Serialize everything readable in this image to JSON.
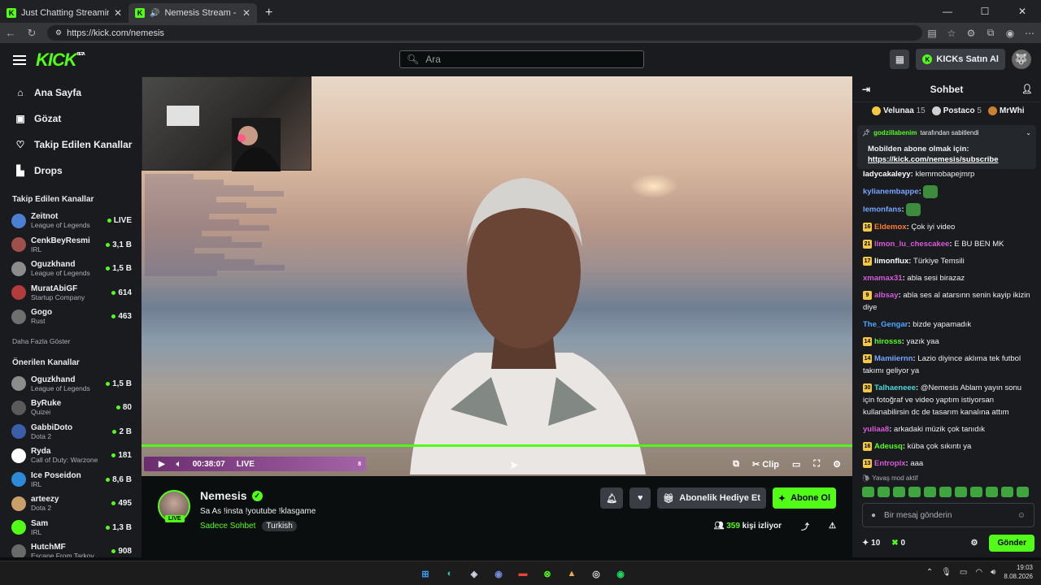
{
  "browser": {
    "tabs": [
      {
        "title": "Just Chatting Streaming - Live Stre",
        "active": false
      },
      {
        "title": "Nemesis Stream - Watch Live",
        "active": true
      }
    ],
    "url": "https://kick.com/nemesis",
    "window_controls": [
      "—",
      "☐",
      "✕"
    ]
  },
  "topnav": {
    "logo": "KICK",
    "logo_beta": "BETA",
    "search_placeholder": "Ara",
    "kicks_button": "KICKs Satın Al"
  },
  "sidebar": {
    "nav": [
      {
        "label": "Ana Sayfa",
        "icon": "home-icon"
      },
      {
        "label": "Gözat",
        "icon": "browse-icon"
      },
      {
        "label": "Takip Edilen Kanallar",
        "icon": "heart-icon"
      },
      {
        "label": "Drops",
        "icon": "drops-icon"
      }
    ],
    "followed_heading": "Takip Edilen Kanallar",
    "followed": [
      {
        "name": "Zeitnot",
        "category": "League of Legends",
        "viewers": "LIVE",
        "color": "#4a7fd4"
      },
      {
        "name": "CenkBeyResmi",
        "category": "IRL",
        "viewers": "3,1 B",
        "color": "#a0504a"
      },
      {
        "name": "Oguzkhand",
        "category": "League of Legends",
        "viewers": "1,5 B",
        "color": "#8c8c8c"
      },
      {
        "name": "MuratAbiGF",
        "category": "Startup Company",
        "viewers": "614",
        "color": "#b23b3b"
      },
      {
        "name": "Gogo",
        "category": "Rust",
        "viewers": "463",
        "color": "#6f6f6f"
      }
    ],
    "show_more": "Daha Fazla Göster",
    "recommended_heading": "Önerilen Kanallar",
    "recommended": [
      {
        "name": "Oguzkhand",
        "category": "League of Legends",
        "viewers": "1,5 B",
        "color": "#8c8c8c"
      },
      {
        "name": "ByRuke",
        "category": "Quizei",
        "viewers": "80",
        "color": "#5a5a5a"
      },
      {
        "name": "GabbiDoto",
        "category": "Dota 2",
        "viewers": "2 B",
        "color": "#3a5fa8"
      },
      {
        "name": "Ryda",
        "category": "Call of Duty: Warzone",
        "viewers": "181",
        "color": "#ffffff"
      },
      {
        "name": "Ice Poseidon",
        "category": "IRL",
        "viewers": "8,6 B",
        "color": "#2d8ad8"
      },
      {
        "name": "arteezy",
        "category": "Dota 2",
        "viewers": "495",
        "color": "#c9a06a"
      },
      {
        "name": "Sam",
        "category": "IRL",
        "viewers": "1,3 B",
        "color": "#53fc18"
      },
      {
        "name": "HutchMF",
        "category": "Escape From Tarkov",
        "viewers": "908",
        "color": "#6a6a6a"
      }
    ]
  },
  "player": {
    "time": "00:38:07",
    "live_label": "LIVE",
    "clip_label": "Clip",
    "volume_level": "8"
  },
  "stream": {
    "name": "Nemesis",
    "live_badge": "LIVE",
    "title": "Sa As  !insta !youtube !klasgame",
    "category": "Sadece Sohbet",
    "tag": "Turkish",
    "gift_button": "Abonelik Hediye Et",
    "subscribe_button": "Abone Ol",
    "viewers": "359",
    "viewers_label": "kişi izliyor"
  },
  "chat": {
    "heading": "Sohbet",
    "leaderboard": [
      {
        "rank": "1",
        "name": "Velunaa",
        "count": "15",
        "color": "#f5c842"
      },
      {
        "rank": "2",
        "name": "Postaco",
        "count": "5",
        "color": "#d0d0d0"
      },
      {
        "rank": "3",
        "name": "MrWhi",
        "count": "",
        "color": "#cd7f32"
      }
    ],
    "pinned_by": "godzillabenim",
    "pinned_suffix": "tarafından sabitlendi",
    "pinned_message": "Mobilden abone olmak için:",
    "pinned_link": "https://kick.com/nemesis/subscribe",
    "messages": [
      {
        "user": "ladycakaleyy",
        "text": "klemmobapejmrp",
        "color": "#ffffff",
        "badge": ""
      },
      {
        "user": "kylianembappe",
        "text": "",
        "color": "#75a7ff",
        "badge": "",
        "emote": true
      },
      {
        "user": "lemonfans",
        "text": "",
        "color": "#75a7ff",
        "badge": "",
        "emote": true
      },
      {
        "user": "Eldemox",
        "text": "Çok iyi video",
        "color": "#ff7b2f",
        "badge": "16"
      },
      {
        "user": "limon_lu_chescakee",
        "text": "E BU BEN MK",
        "color": "#d85ad8",
        "badge": "21"
      },
      {
        "user": "limonflux",
        "text": "Türkiye Temsili",
        "color": "#ffffff",
        "badge": "17"
      },
      {
        "user": "xmamax31",
        "text": "abla sesi birazaz",
        "color": "#d85ad8",
        "badge": ""
      },
      {
        "user": "albsay",
        "text": "abla ses al atarsınn senin kayip ikizin diye",
        "color": "#d85ad8",
        "badge": "9"
      },
      {
        "user": "The_Gengar",
        "text": "bizde yapamadık",
        "color": "#4aa8ff",
        "badge": ""
      },
      {
        "user": "hirosss",
        "text": "yazık yaa",
        "color": "#53fc18",
        "badge": "14"
      },
      {
        "user": "Mamiiernn",
        "text": "Lazio diyince aklıma tek futbol takımı geliyor ya",
        "color": "#75a7ff",
        "badge": "14"
      },
      {
        "user": "Talhaeneee",
        "text": "@Nemesis Ablam yayın sonu için fotoğraf ve video yaptım istiyorsan kullanabilirsin dc de tasarım kanalına attım",
        "color": "#4ad8d8",
        "badge": "30"
      },
      {
        "user": "yuliaa8",
        "text": "arkadaki müzik çok tanıdık",
        "color": "#d85ad8",
        "badge": ""
      },
      {
        "user": "Adeusq",
        "text": "küba çok sıkıntı ya",
        "color": "#53fc18",
        "badge": "16"
      },
      {
        "user": "Entropix",
        "text": "aaa",
        "color": "#d85ad8",
        "badge": "13"
      }
    ],
    "slow_mode": "Yavaş mod aktif",
    "input_placeholder": "Bir mesaj gönderin",
    "kicks_count": "10",
    "coins_count": "0",
    "send_button": "Gönder"
  },
  "taskbar": {
    "time": "19:03",
    "date": "8.08.2026"
  }
}
